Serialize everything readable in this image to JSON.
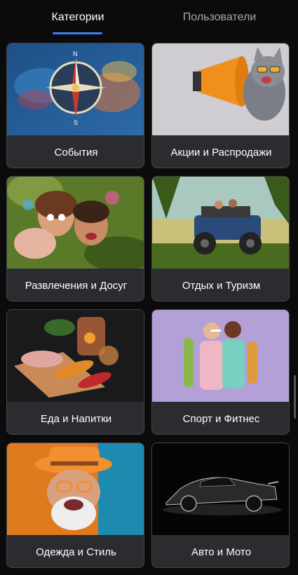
{
  "tabs": [
    {
      "label": "Категории",
      "active": true
    },
    {
      "label": "Пользователи",
      "active": false
    }
  ],
  "accent_color": "#3d7df2",
  "categories": [
    {
      "label": "События",
      "image": "compass-icon"
    },
    {
      "label": "Акции и Распродажи",
      "image": "cat-megaphone-image"
    },
    {
      "label": "Развлечения и Досуг",
      "image": "friends-party-image"
    },
    {
      "label": "Отдых и Туризм",
      "image": "offroad-jeep-image"
    },
    {
      "label": "Еда и Напитки",
      "image": "food-drinks-image"
    },
    {
      "label": "Спорт и Фитнес",
      "image": "fitness-couple-image"
    },
    {
      "label": "Одежда и Стиль",
      "image": "stylish-grandpa-image"
    },
    {
      "label": "Авто и Мото",
      "image": "sports-car-image"
    }
  ]
}
